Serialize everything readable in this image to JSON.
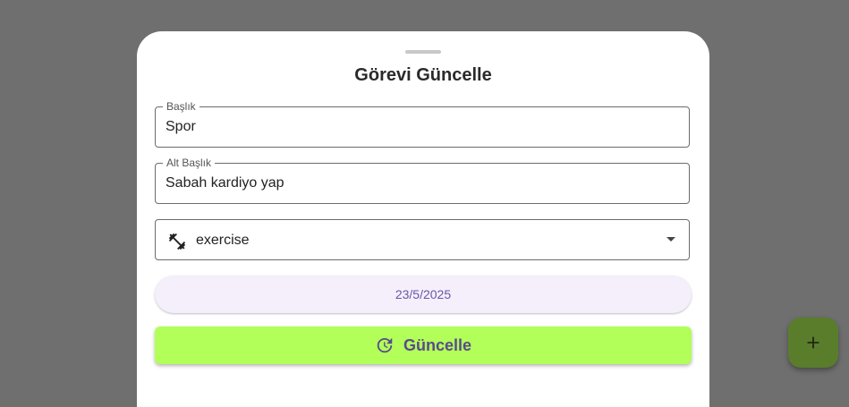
{
  "dialog": {
    "title": "Görevi Güncelle",
    "title_field": {
      "label": "Başlık",
      "value": "Spor"
    },
    "subtitle_field": {
      "label": "Alt Başlık",
      "value": "Sabah kardiyo yap"
    },
    "icon_select": {
      "icon": "fitness-center-icon",
      "value": "exercise"
    },
    "date_button": {
      "label": "23/5/2025"
    },
    "update_button": {
      "label": "Güncelle",
      "icon": "update-icon"
    }
  },
  "fab": {
    "icon": "add-icon"
  },
  "colors": {
    "scrim": "#6f6f6f",
    "update_button_bg": "#b2ff59",
    "date_button_bg": "#f4effa",
    "accent_text": "#6b56a8",
    "fab_bg": "#5a7d2c"
  }
}
